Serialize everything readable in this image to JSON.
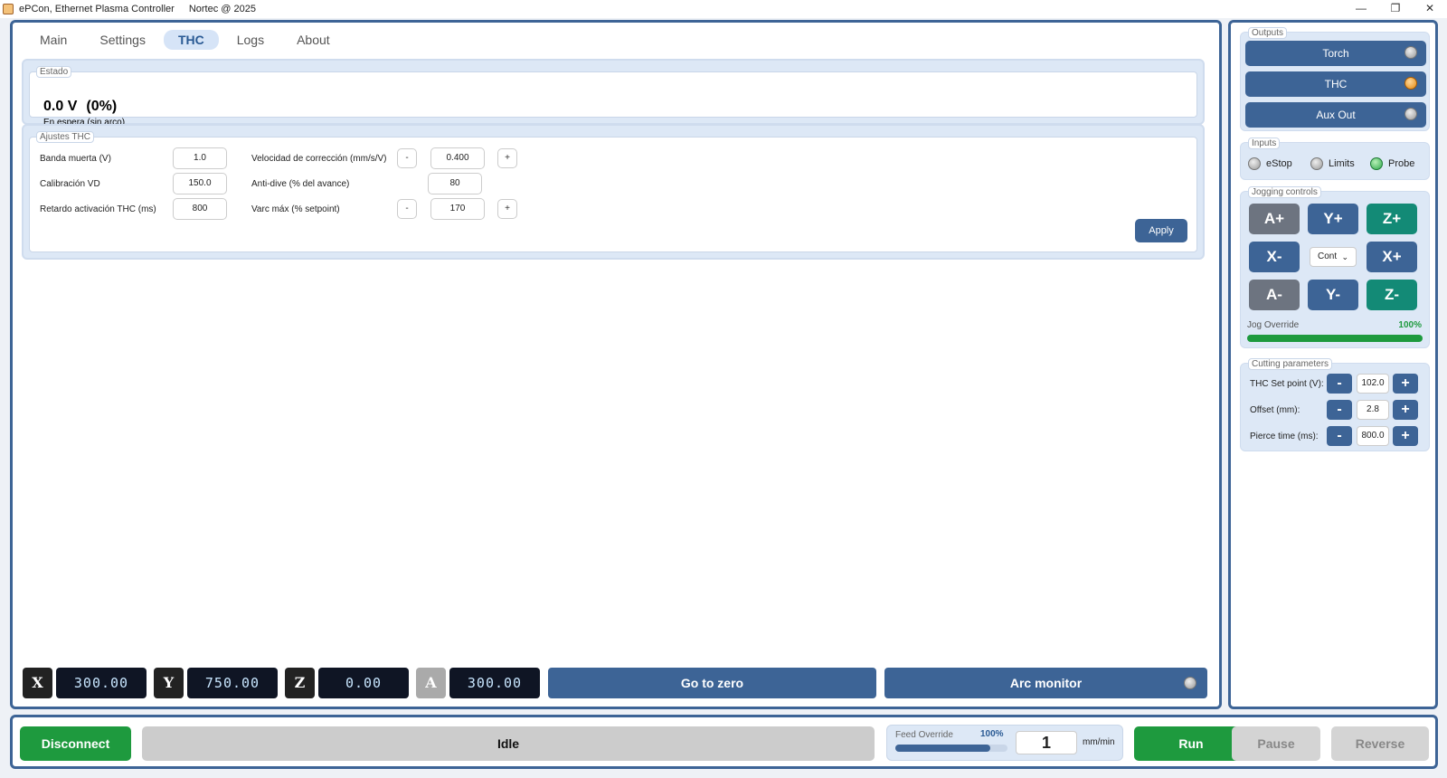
{
  "window": {
    "app_title": "ePCon, Ethernet Plasma Controller",
    "company": "Nortec @ 2025",
    "minimize": "—",
    "maximize": "❐",
    "close": "✕"
  },
  "tabs": [
    {
      "label": "Main"
    },
    {
      "label": "Settings"
    },
    {
      "label": "THC",
      "active": true
    },
    {
      "label": "Logs"
    },
    {
      "label": "About"
    }
  ],
  "estado": {
    "group_label": "Estado",
    "voltage": "0.0 V",
    "percent": "(0%)",
    "status": "En espera (sin arco)"
  },
  "ajustes": {
    "group_label": "Ajustes THC",
    "banda_label": "Banda muerta (V)",
    "banda_value": "1.0",
    "calib_label": "Calibración VD",
    "calib_value": "150.0",
    "retardo_label": "Retardo activación THC (ms)",
    "retardo_value": "800",
    "velocidad_label": "Velocidad de corrección (mm/s/V)",
    "velocidad_value": "0.400",
    "antidive_label": "Anti-dive (% del avance)",
    "antidive_value": "80",
    "varc_label": "Varc máx (% setpoint)",
    "varc_value": "170",
    "minus": "-",
    "plus": "+",
    "apply_label": "Apply"
  },
  "dro": {
    "x_label": "X",
    "x_value": "300.00",
    "y_label": "Y",
    "y_value": "750.00",
    "z_label": "Z",
    "z_value": "0.00",
    "a_label": "A",
    "a_value": "300.00"
  },
  "actions": {
    "go_to_zero": "Go to zero",
    "arc_monitor": "Arc monitor"
  },
  "outputs": {
    "group_label": "Outputs",
    "torch": "Torch",
    "thc": "THC",
    "aux": "Aux Out"
  },
  "inputs": {
    "group_label": "Inputs",
    "estop": "eStop",
    "limits": "Limits",
    "probe": "Probe"
  },
  "jogging": {
    "group_label": "Jogging controls",
    "a_plus": "A+",
    "y_plus": "Y+",
    "z_plus": "Z+",
    "x_minus": "X-",
    "mode": "Cont",
    "x_plus": "X+",
    "a_minus": "A-",
    "y_minus": "Y-",
    "z_minus": "Z-",
    "override_label": "Jog Override",
    "override_value": "100%",
    "override_fraction": 1.0
  },
  "cutting": {
    "group_label": "Cutting parameters",
    "setpoint_label": "THC Set point (V):",
    "setpoint_value": "102.0",
    "offset_label": "Offset (mm):",
    "offset_value": "2.8",
    "pierce_label": "Pierce time (ms):",
    "pierce_value": "800.0",
    "minus": "-",
    "plus": "+"
  },
  "bottom": {
    "disconnect": "Disconnect",
    "status": "Idle",
    "feed_label": "Feed Override",
    "feed_percent": "100%",
    "feed_fraction": 0.85,
    "feed_value": "1",
    "feed_unit": "mm/min",
    "run": "Run",
    "pause": "Pause",
    "reverse": "Reverse"
  },
  "colors": {
    "accent": "#3d6496",
    "green": "#1e9a3e",
    "teal": "#138a76",
    "gray": "#6d7480"
  }
}
